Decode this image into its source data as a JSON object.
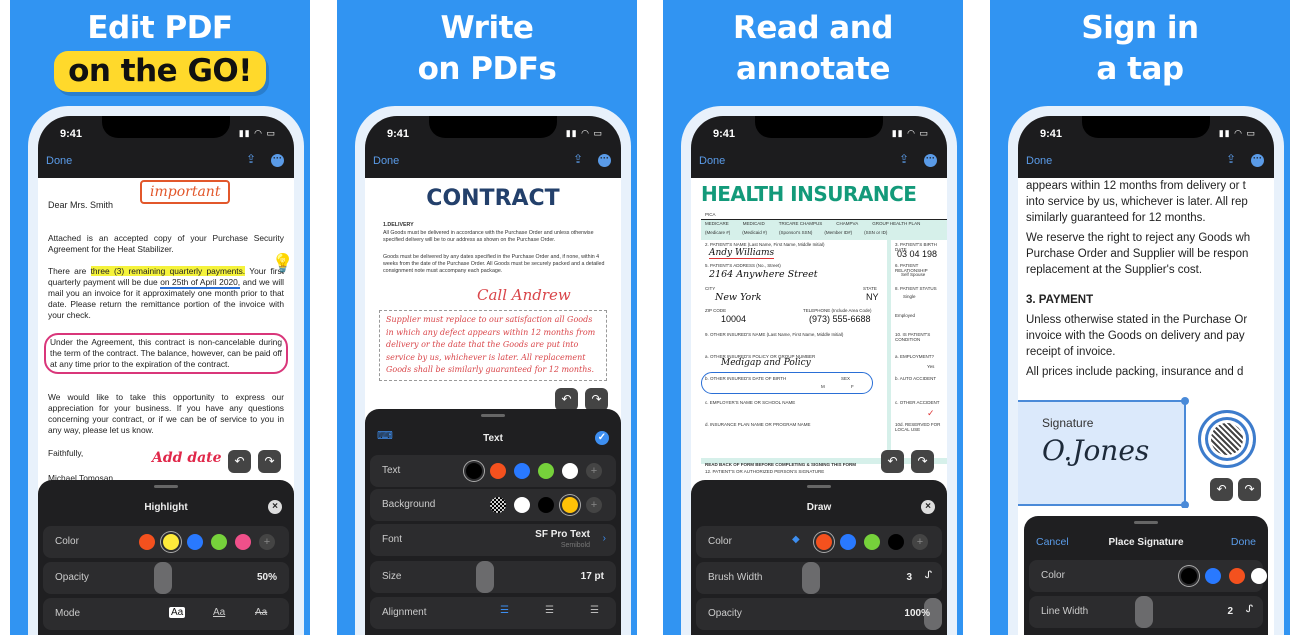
{
  "colors": {
    "background": "#3194f2",
    "accent": "#5a9be8",
    "sheet": "#1f1f21",
    "highlight": "#ffd92b"
  },
  "status": {
    "time": "9:41",
    "done": "Done"
  },
  "panels": [
    {
      "headline": [
        "Edit PDF",
        "on the GO!"
      ],
      "doc": {
        "greeting": "Dear Mrs. Smith",
        "note_important": "important",
        "p1": "Attached is an accepted copy of your Purchase Security Agreement for the Heat Stabilizer.",
        "p2_pre": "There are ",
        "p2_highlight": "three (3) remaining quarterly payments.",
        "p2_mid": " Your first quarterly payment will be due ",
        "p2_underline": "on 25th of April 2020,",
        "p2_post": " and we will mail you an invoice for it approximately one month prior to that date. Please return the remittance portion of the invoice with your check.",
        "p3": "Under the Agreement, this contract is non-cancelable during the term of the contract. The balance, however, can be paid off at any time prior to the expiration of the contract.",
        "p4": "We would like to take this opportunity to express our appreciation for your business. If you have any questions concerning your contract, or if we can be of service to you in any way, please let us know.",
        "closing": "Faithfully,",
        "signer": "Michael Tomosan",
        "note_add_date": "Add date"
      },
      "sheet": {
        "title": "Highlight",
        "rows": [
          {
            "label": "Color",
            "colors": [
              "#f4511e",
              "#ffeb3b",
              "#2979ff",
              "#76d13b",
              "#f0508a"
            ],
            "selected": 1
          },
          {
            "label": "Opacity",
            "value": "50%",
            "level": 0.5
          },
          {
            "label": "Mode",
            "options": [
              "Aa",
              "Aa",
              "Aa"
            ]
          }
        ]
      }
    },
    {
      "headline": [
        "Write",
        "on PDFs"
      ],
      "doc": {
        "title": "CONTRACT",
        "section": "1.DELIVERY",
        "p1": "All Goods must be delivered in accordance with the Purchase Order and unless otherwise specified delivery will be to our address as shown on the Purchase Order.",
        "p2": "Goods must be delivered by any dates specified in the Purchase Order and, if none, within 4 weeks from the date of the Purchase Order. All Goods must be securely packed and a detailed consignment note must accompany each package.",
        "note": "Call Andrew",
        "handwriting": "Supplier must replace to our satisfaction all Goods in which any defect appears within 12 months from delivery or the date that the Goods are put into service by us, whichever is later. All replacement Goods shall be similarly guaranteed for 12 months."
      },
      "sheet": {
        "title": "Text",
        "rows": [
          {
            "label": "Text",
            "colors": [
              "#000000",
              "#f4511e",
              "#2979ff",
              "#76d13b",
              "#ffffff"
            ],
            "selected": 0
          },
          {
            "label": "Background",
            "colors": [
              "transparent",
              "#ffffff",
              "#000000",
              "#ffc107"
            ],
            "selected": 3
          },
          {
            "label": "Font",
            "value": "SF Pro Text",
            "sub": "Semibold"
          },
          {
            "label": "Size",
            "value": "17 pt",
            "level": 0.45
          },
          {
            "label": "Alignment",
            "options": [
              "left",
              "center",
              "right"
            ],
            "selected": 0
          }
        ]
      }
    },
    {
      "headline": [
        "Read and",
        "annotate"
      ],
      "doc": {
        "title": "HEALTH INSURANCE",
        "pica": "PICA",
        "row1": [
          "MEDICARE",
          "MEDICAID",
          "TRICARE CHAMPUS",
          "CHAMPVA",
          "GROUP HEALTH PLAN"
        ],
        "row1b": [
          "(Medicare #)",
          "(Medicaid #)",
          "(Sponsor's SSN)",
          "(Member ID#)",
          "(SSN or ID)"
        ],
        "f2": "2. PATIENT'S NAME (Last Name, First Name, Middle Initial)",
        "name": "Andy Williams",
        "f3": "3. PATIENT'S BIRTH DATE",
        "dob": "03  04  198",
        "f5": "5. PATIENT'S ADDRESS (No., Street)",
        "address": "2164 Anywhere Street",
        "f6": "6. PATIENT RELATIONSHIP",
        "f6v": "Self  Spouse",
        "city_l": "CITY",
        "city": "New York",
        "state_l": "STATE",
        "state": "NY",
        "f8": "8. PATIENT STATUS",
        "f8v": "Single",
        "zip_l": "ZIP CODE",
        "zip": "10004",
        "tel_l": "TELEPHONE (Include Area Code)",
        "tel": "(973) 555-6688",
        "f8b": "Employed",
        "f9": "9. OTHER INSURED'S NAME (Last Name, First Name, Middle Initial)",
        "f10": "10. IS PATIENT'S CONDITION",
        "f9a": "a. OTHER INSURED'S POLICY OR GROUP NUMBER",
        "policy": "Medigap and Policy",
        "f10a": "a. EMPLOYMENT?",
        "yes": "Yes",
        "f9b": "b. OTHER INSURED'S DATE OF BIRTH",
        "sex": "SEX",
        "m": "M",
        "f": "F",
        "f10b": "b. AUTO ACCIDENT",
        "f9c": "c. EMPLOYER'S NAME OR SCHOOL NAME",
        "f10c": "c. OTHER ACCIDENT",
        "f9d": "d. INSURANCE PLAN NAME OR PROGRAM NAME",
        "f10d": "10d. RESERVED FOR LOCAL USE",
        "footer": "READ BACK OF FORM BEFORE COMPLETING & SIGNING THIS FORM",
        "f12": "12. PATIENT'S OR AUTHORIZED PERSON'S SIGNATURE"
      },
      "sheet": {
        "title": "Draw",
        "rows": [
          {
            "label": "Color",
            "colors": [
              "#f4511e",
              "#2979ff",
              "#76d13b",
              "#000000"
            ],
            "selected": 0
          },
          {
            "label": "Brush Width",
            "value": "3",
            "level": 0.5
          },
          {
            "label": "Opacity",
            "value": "100%",
            "level": 1
          }
        ]
      }
    },
    {
      "headline": [
        "Sign in",
        "a tap"
      ],
      "doc": {
        "lines": [
          "appears within 12 months from delivery or t",
          "into service by us, whichever is later. All rep",
          "similarly guaranteed for 12 months.",
          "We reserve the right to reject any Goods wh",
          "Purchase Order and Supplier will be respon",
          "replacement at the Supplier's cost."
        ],
        "section": "3. PAYMENT",
        "lines2": [
          "Unless otherwise stated in the Purchase Or",
          "invoice with the Goods on delivery and pay",
          "receipt of invoice.",
          "All prices include packing, insurance and d"
        ],
        "sig_label": "Signature",
        "sig": "O.Jones"
      },
      "sheet": {
        "cancel": "Cancel",
        "title": "Place Signature",
        "done": "Done",
        "rows": [
          {
            "label": "Color",
            "colors": [
              "#000000",
              "#2979ff",
              "#f4511e",
              "#ffffff"
            ],
            "selected": 0
          },
          {
            "label": "Line Width",
            "value": "2",
            "level": 0.55
          }
        ]
      }
    }
  ]
}
